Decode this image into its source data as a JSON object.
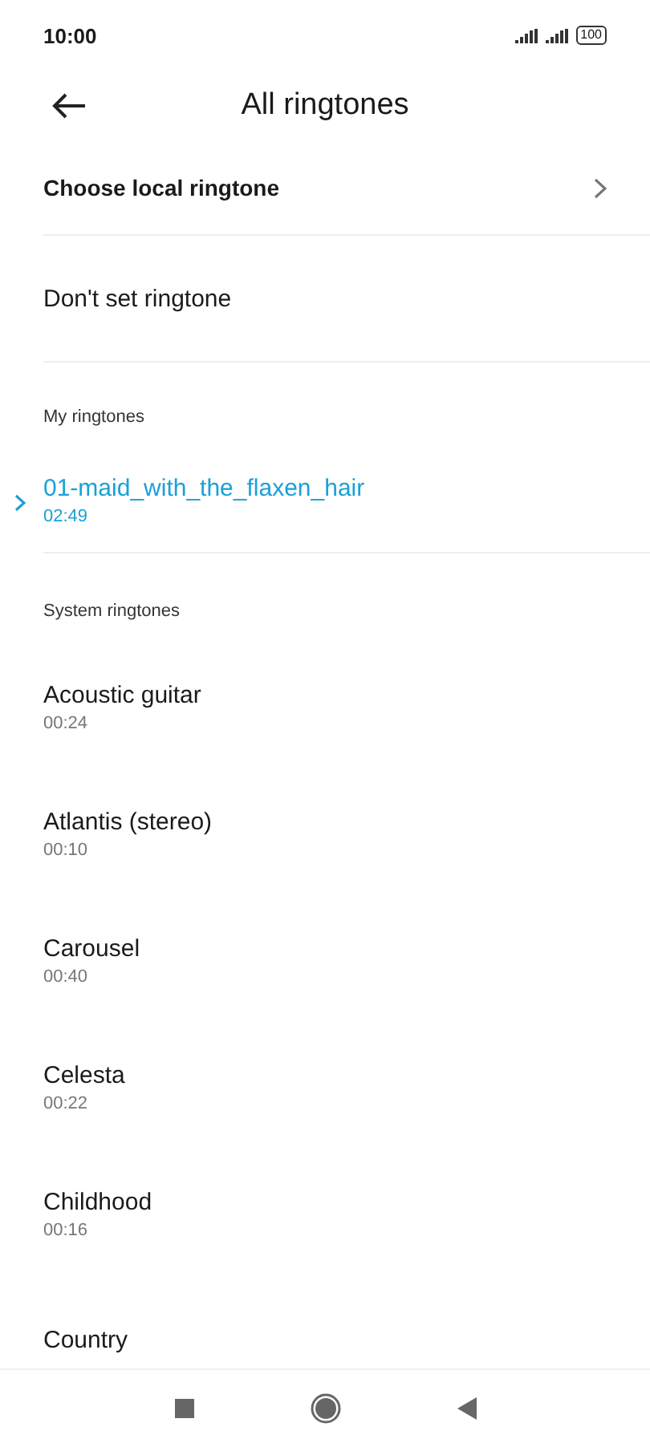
{
  "status_bar": {
    "time": "10:00",
    "battery": "100"
  },
  "header": {
    "title": "All ringtones"
  },
  "actions": [
    {
      "label": "Choose local ringtone",
      "kind": "link"
    },
    {
      "label": "Don't set ringtone",
      "kind": "plain"
    }
  ],
  "sections": [
    {
      "title": "My ringtones",
      "items": [
        {
          "name": "01-maid_with_the_flaxen_hair",
          "duration": "02:49",
          "selected": true
        }
      ]
    },
    {
      "title": "System ringtones",
      "items": [
        {
          "name": "Acoustic guitar",
          "duration": "00:24",
          "selected": false
        },
        {
          "name": "Atlantis (stereo)",
          "duration": "00:10",
          "selected": false
        },
        {
          "name": "Carousel",
          "duration": "00:40",
          "selected": false
        },
        {
          "name": "Celesta",
          "duration": "00:22",
          "selected": false
        },
        {
          "name": "Childhood",
          "duration": "00:16",
          "selected": false
        },
        {
          "name": "Country",
          "selected": false
        }
      ]
    }
  ]
}
